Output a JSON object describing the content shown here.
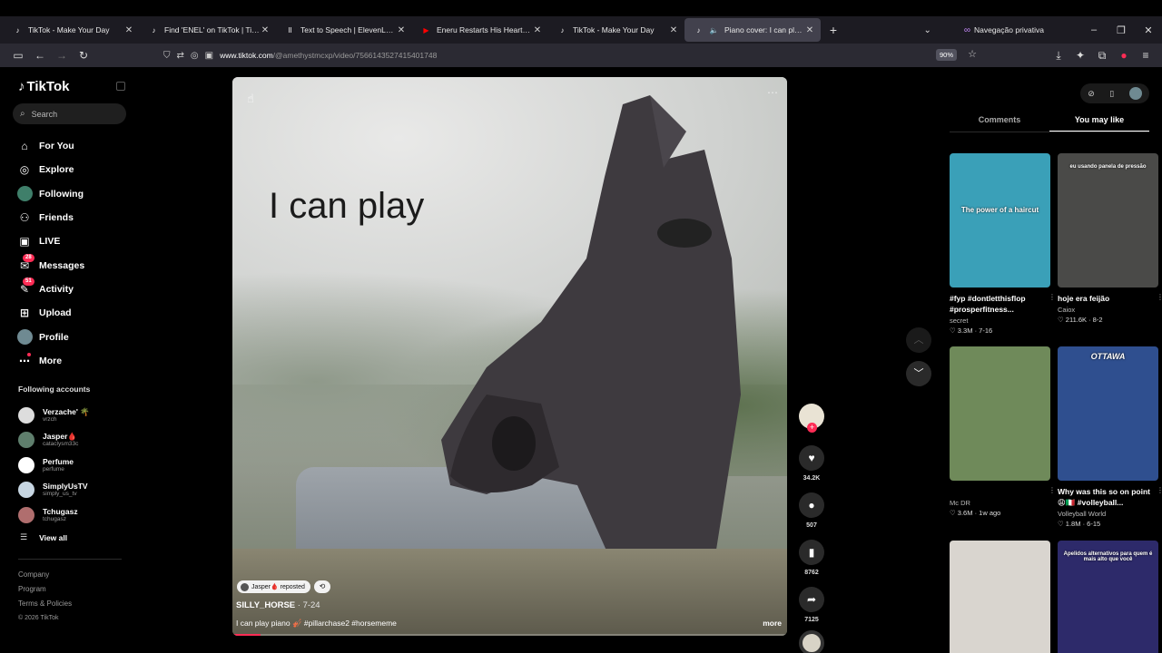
{
  "browser": {
    "tabs": [
      {
        "title": "TikTok - Make Your Day",
        "icon": "tiktok-icon",
        "color": "#ffffff",
        "active": false
      },
      {
        "title": "Find 'ENEL' on TikTok | TikTok S",
        "icon": "tiktok-icon",
        "color": "#ffffff",
        "active": false
      },
      {
        "title": "Text to Speech | ElevenLabs",
        "icon": "elevenlabs-icon",
        "color": "#ffffff",
        "active": false
      },
      {
        "title": "Eneru Restarts His Heart - YouT",
        "icon": "youtube-icon",
        "color": "#ff0000",
        "active": false
      },
      {
        "title": "TikTok - Make Your Day",
        "icon": "tiktok-icon",
        "color": "#ffffff",
        "active": false
      },
      {
        "title": "Piano cover: I can play pian",
        "icon": "tiktok-icon",
        "color": "#ffffff",
        "active": true
      }
    ],
    "private_label": "Navegação privativa",
    "url_host": "www.tiktok.com",
    "url_path": "/@amethystmcxp/video/7566143527415401748",
    "zoom": "90%"
  },
  "sidebar": {
    "logo": "TikTok",
    "search_placeholder": "Search",
    "menu": [
      {
        "label": "For You",
        "icon": "home-icon"
      },
      {
        "label": "Explore",
        "icon": "compass-icon"
      },
      {
        "label": "Following",
        "icon": "following-avatar-icon"
      },
      {
        "label": "Friends",
        "icon": "friends-icon"
      },
      {
        "label": "LIVE",
        "icon": "live-icon"
      },
      {
        "label": "Messages",
        "icon": "messages-icon",
        "badge": "28"
      },
      {
        "label": "Activity",
        "icon": "activity-icon",
        "badge": "51"
      },
      {
        "label": "Upload",
        "icon": "upload-icon"
      },
      {
        "label": "Profile",
        "icon": "profile-avatar-icon"
      },
      {
        "label": "More",
        "icon": "more-icon"
      }
    ],
    "following_header": "Following accounts",
    "following": [
      {
        "name": "Verzache' 🌴",
        "handle": "vrzch",
        "color": "#dddddd"
      },
      {
        "name": "Jasper🩸",
        "handle": "cataclysm33c",
        "color": "#5f7f6d"
      },
      {
        "name": "Perfume",
        "handle": "perfume",
        "color": "#ffffff"
      },
      {
        "name": "SimplyUsTV",
        "handle": "simply_us_tv",
        "color": "#c7d6e2"
      },
      {
        "name": "Tchugasz",
        "handle": "tchugasz",
        "color": "#b06e6e"
      }
    ],
    "view_all": "View all",
    "footer": [
      "Company",
      "Program",
      "Terms & Policies"
    ],
    "copyright": "© 2026 TikTok"
  },
  "video": {
    "caption_overlay": "I can play",
    "reposted_by": "Jasper🩸 reposted",
    "author": "SILLY_HORSE",
    "date": " · 7-24",
    "description": "I can play piano 🎻 #pillarchase2 #horsememe",
    "more": "more",
    "progress": 0.05,
    "likes": "34.2K",
    "comments": "507",
    "saves": "8762",
    "shares": "7125"
  },
  "right_panel": {
    "tabs": [
      "Comments",
      "You may like"
    ],
    "active_tab": "You may like",
    "cards": [
      {
        "title": "#fyp #dontletthisflop #prosperfitness...",
        "author": "secret",
        "stats": "♡ 3.3M · 7-16",
        "overlay": "The power of a haircut",
        "bg": "#3aa0b8"
      },
      {
        "title": "hoje era feijão",
        "author": "Caiox",
        "stats": "♡ 211.6K · 8-2",
        "overlay": "eu usando panela de pressão",
        "bg": "#4a4a48"
      },
      {
        "title": "",
        "author": "Mc DR",
        "stats": "♡ 3.6M · 1w ago",
        "overlay": "",
        "bg": "#6f8a5a"
      },
      {
        "title": "Why was this so on point 😩🇮🇹 #volleyball...",
        "author": "Volleyball World",
        "stats": "♡ 1.8M · 6-15",
        "overlay": "OTTAWA",
        "bg": "#2f4f8f"
      },
      {
        "title": "",
        "author": "",
        "stats": "",
        "overlay": "",
        "bg": "#d9d5cf"
      },
      {
        "title": "",
        "author": "",
        "stats": "",
        "overlay": "Apelidos alternativos para quem é mais alto que você",
        "bg": "#2d2a6a"
      }
    ]
  }
}
